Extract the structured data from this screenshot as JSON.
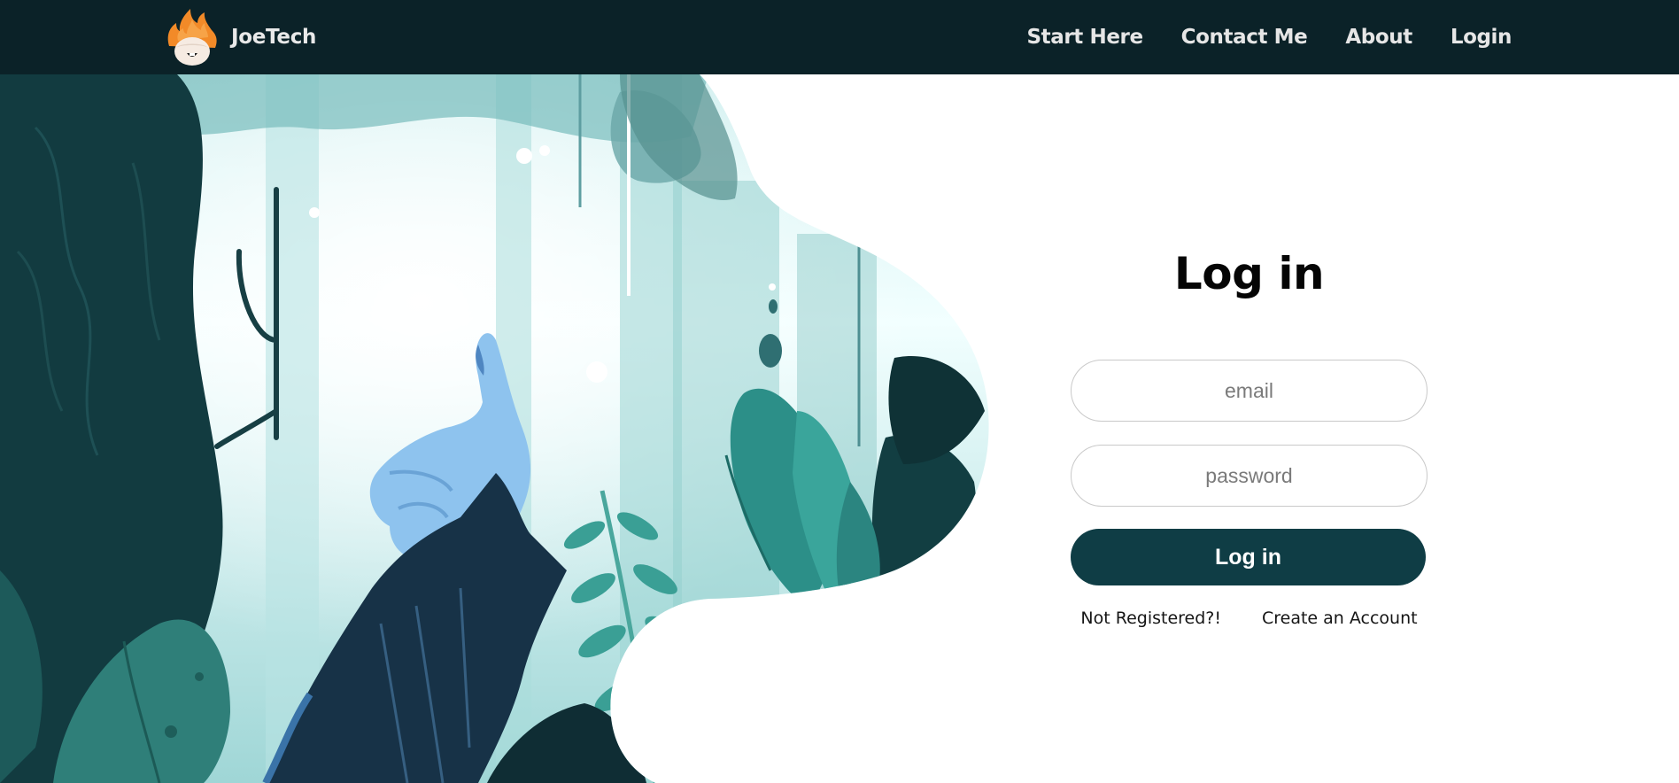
{
  "brand": {
    "name": "JoeTech",
    "logo_icon": "flame-hair-face-icon"
  },
  "nav": {
    "items": [
      {
        "label": "Start Here"
      },
      {
        "label": "Contact Me"
      },
      {
        "label": "About"
      },
      {
        "label": "Login"
      }
    ]
  },
  "login": {
    "title": "Log in",
    "email_placeholder": "email",
    "password_placeholder": "password",
    "submit_label": "Log in",
    "not_registered_text": "Not Registered?!",
    "create_account_label": "Create an Account"
  },
  "colors": {
    "navbar_bg": "#0b2228",
    "button_bg": "#0f3d45",
    "text": "#050505",
    "illustration_teal": "#3fa69c",
    "illustration_dark": "#123a3f",
    "illustration_light": "#e6fbfb"
  }
}
